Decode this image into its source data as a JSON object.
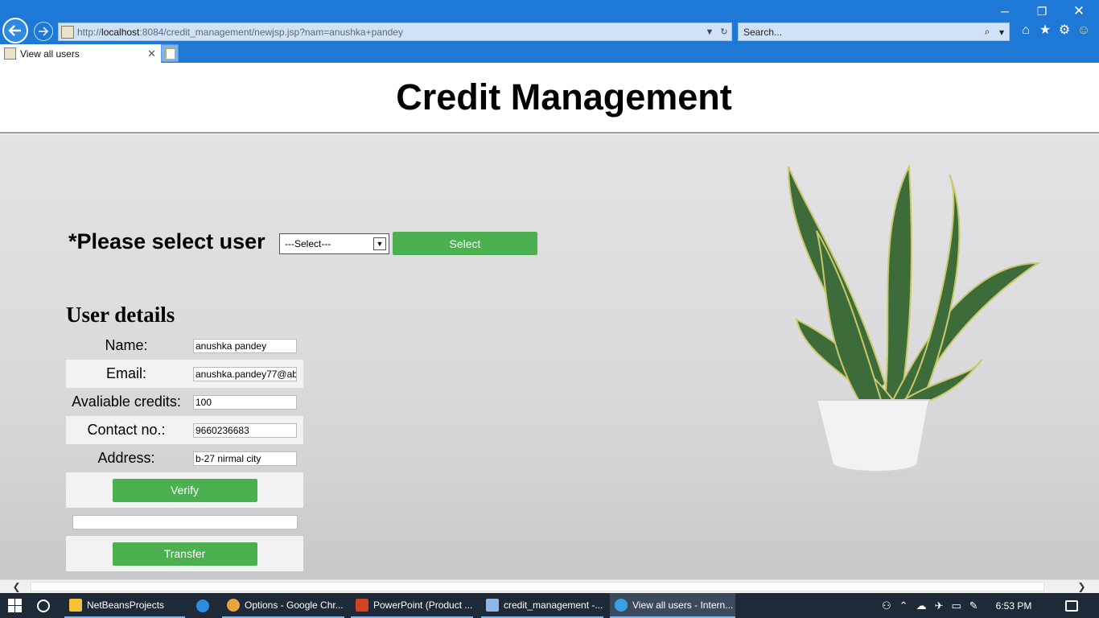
{
  "browser": {
    "url_prefix": "http://",
    "url_host": "localhost",
    "url_rest": ":8084/credit_management/newjsp.jsp?nam=anushka+pandey",
    "search_placeholder": "Search...",
    "tab_title": "View all users"
  },
  "page": {
    "title": "Credit Management",
    "select_label": "*Please select user",
    "select_value": "---Select---",
    "select_button": "Select",
    "details_title": "User details",
    "fields": [
      {
        "label": "Name:",
        "value": "anushka pandey"
      },
      {
        "label": "Email:",
        "value": "anushka.pandey77@ab"
      },
      {
        "label": "Avaliable credits:",
        "value": "100"
      },
      {
        "label": "Contact no.:",
        "value": "9660236683"
      },
      {
        "label": "Address:",
        "value": "b-27 nirmal city"
      }
    ],
    "verify_button": "Verify",
    "transfer_button": "Transfer",
    "transfer_input_value": ""
  },
  "taskbar": {
    "items": [
      {
        "label": "NetBeansProjects",
        "icon": "folder-icon",
        "color": "#f3c33b"
      },
      {
        "label": "",
        "icon": "edge-icon",
        "color": "#2b8de0"
      },
      {
        "label": "Options - Google Chr...",
        "icon": "chrome-icon",
        "color": "#e8a33b"
      },
      {
        "label": "PowerPoint (Product ...",
        "icon": "powerpoint-icon",
        "color": "#d04423"
      },
      {
        "label": "credit_management -...",
        "icon": "netbeans-icon",
        "color": "#8fb8e6"
      },
      {
        "label": "View all users - Intern...",
        "icon": "ie-icon",
        "color": "#3aa0e8"
      }
    ],
    "clock": "6:53 PM"
  },
  "colors": {
    "chrome_blue": "#1e78d6",
    "button_green": "#4caf50",
    "taskbar": "#1e2a38"
  }
}
